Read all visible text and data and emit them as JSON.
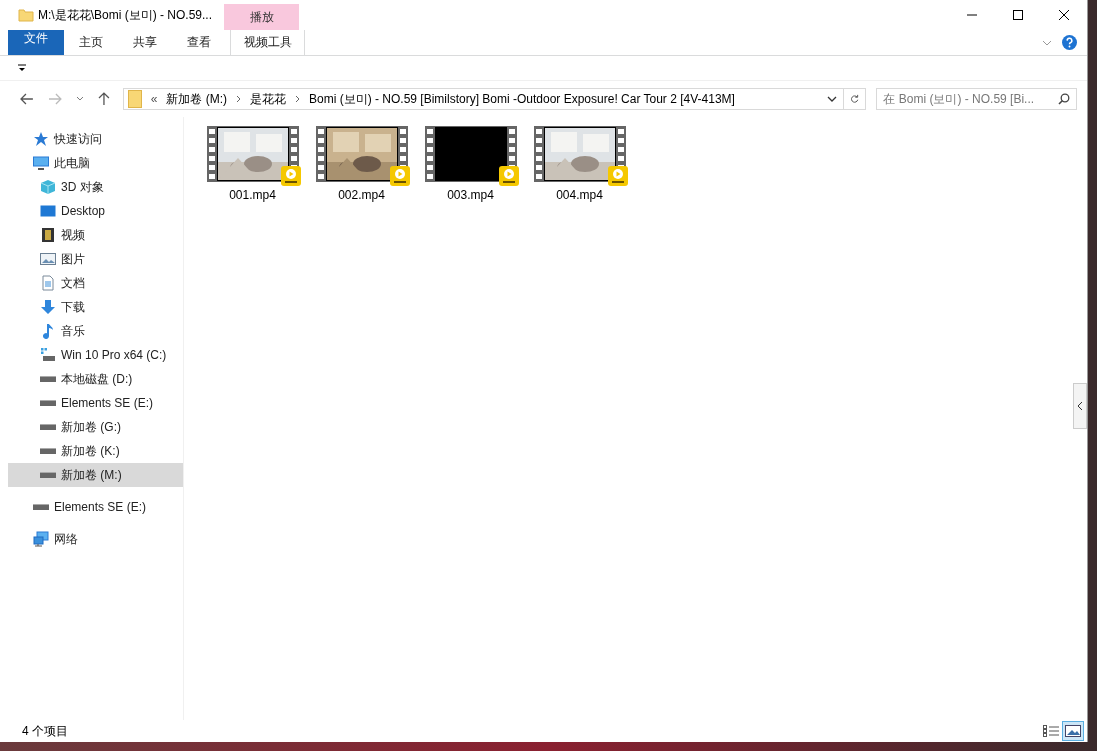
{
  "window": {
    "title": "M:\\是花花\\Bomi (보미) - NO.59...",
    "context_header": "播放"
  },
  "ribbon_tabs": [
    {
      "label": "文件",
      "kind": "file"
    },
    {
      "label": "主页",
      "kind": "tab"
    },
    {
      "label": "共享",
      "kind": "tab"
    },
    {
      "label": "查看",
      "kind": "tab"
    },
    {
      "label": "视频工具",
      "kind": "context"
    }
  ],
  "address": {
    "overflow": "«",
    "crumbs": [
      "新加卷 (M:)",
      "是花花",
      "Bomi (보미) - NO.59 [Bimilstory] Bomi -Outdoor Exposure! Car Tour 2 [4V-413M]"
    ]
  },
  "search": {
    "placeholder": "在 Bomi (보미) - NO.59 [Bi..."
  },
  "sidebar": [
    {
      "label": "快速访问",
      "kind": "star",
      "selected": false
    },
    {
      "label": "此电脑",
      "kind": "pc",
      "selected": false,
      "children": [
        {
          "label": "3D 对象",
          "kind": "cube",
          "selected": false
        },
        {
          "label": "Desktop",
          "kind": "desktop",
          "selected": false
        },
        {
          "label": "视频",
          "kind": "video",
          "selected": false
        },
        {
          "label": "图片",
          "kind": "pictures",
          "selected": false
        },
        {
          "label": "文档",
          "kind": "document",
          "selected": false
        },
        {
          "label": "下载",
          "kind": "download",
          "selected": false
        },
        {
          "label": "音乐",
          "kind": "music",
          "selected": false
        },
        {
          "label": "Win 10 Pro x64 (C:)",
          "kind": "system-drive",
          "selected": false
        },
        {
          "label": "本地磁盘 (D:)",
          "kind": "drive",
          "selected": false
        },
        {
          "label": "Elements SE (E:)",
          "kind": "drive",
          "selected": false
        },
        {
          "label": "新加卷 (G:)",
          "kind": "drive",
          "selected": false
        },
        {
          "label": "新加卷 (K:)",
          "kind": "drive",
          "selected": false
        },
        {
          "label": "新加卷 (M:)",
          "kind": "drive",
          "selected": true
        }
      ]
    },
    {
      "label": "Elements SE (E:)",
      "kind": "drive",
      "selected": false
    },
    {
      "label": "网络",
      "kind": "network",
      "selected": false
    }
  ],
  "files": [
    {
      "name": "001.mp4",
      "kind": "picture"
    },
    {
      "name": "002.mp4",
      "kind": "picture"
    },
    {
      "name": "003.mp4",
      "kind": "blank"
    },
    {
      "name": "004.mp4",
      "kind": "picture"
    }
  ],
  "status_bar": {
    "count": "4 个项目"
  },
  "view_buttons": [
    {
      "kind": "details",
      "selected": false
    },
    {
      "kind": "thumbnails",
      "selected": true
    }
  ]
}
